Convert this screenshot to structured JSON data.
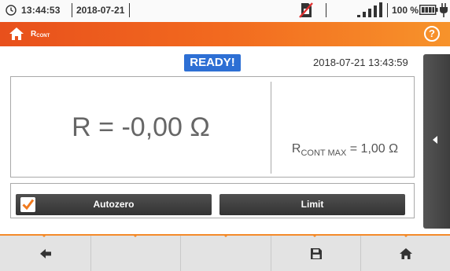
{
  "status_bar": {
    "time": "13:44:53",
    "date": "2018-07-21",
    "battery_percent": "100 %",
    "icons": [
      "clock-icon",
      "sim-disabled-icon",
      "signal-bars-icon",
      "battery-icon",
      "power-plug-icon"
    ]
  },
  "header": {
    "title_main": "R",
    "title_sub": "CONT",
    "help_label": "?",
    "icons": [
      "home-icon",
      "help-icon"
    ]
  },
  "status": {
    "ready_label": "READY!",
    "timestamp": "2018-07-21 13:43:59"
  },
  "measurement": {
    "result": "R = -0,00 Ω",
    "limit_main": "R",
    "limit_sub": "CONT MAX",
    "limit_value": " = 1,00 Ω"
  },
  "controls": {
    "autozero_label": "Autozero",
    "autozero_checked": true,
    "limit_label": "Limit"
  },
  "bottom_nav": [
    "back-arrow-icon",
    "",
    "",
    "save-icon",
    "home-icon"
  ],
  "colors": {
    "header_start": "#e8501c",
    "header_end": "#f7932b",
    "ready_badge": "#2d6fd4",
    "checkbox_accent": "#f07a1e",
    "button_dark": "#404040"
  }
}
